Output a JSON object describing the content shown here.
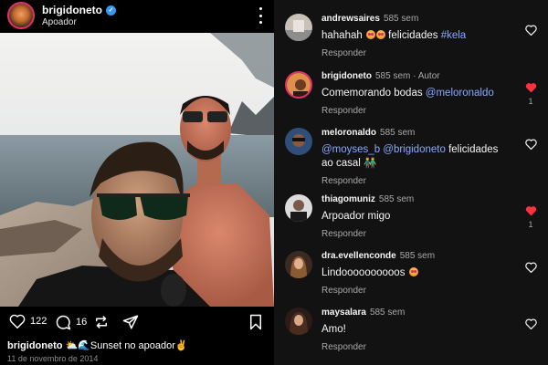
{
  "post": {
    "username": "brigidoneto",
    "location": "Apoador",
    "likes": "122",
    "comments": "16",
    "caption_user": "brigidoneto",
    "caption_text": "⛅🌊Sunset no apoador✌",
    "date": "11 de novembro de 2014"
  },
  "comments": [
    {
      "user": "andrewsaires",
      "time": "585 sem",
      "author_tag": "",
      "text": "hahahah ",
      "emojis": 2,
      "text_after": " felicidades ",
      "mention": "#kela",
      "reply": "Responder",
      "liked": false,
      "like_count": ""
    },
    {
      "user": "brigidoneto",
      "time": "585 sem",
      "author_tag": "· Autor",
      "text": "Comemorando bodas ",
      "emojis": 0,
      "text_after": "",
      "mention": "@meloronaldo",
      "reply": "Responder",
      "liked": true,
      "like_count": "1"
    },
    {
      "user": "meloronaldo",
      "time": "585 sem",
      "author_tag": "",
      "text": "",
      "emojis": 0,
      "text_after": "",
      "mention": "@moyses_b @brigidoneto",
      "text_tail": " felicidades ao casal 👬",
      "reply": "Responder",
      "liked": false,
      "like_count": ""
    },
    {
      "user": "thiagomuniz",
      "time": "585 sem",
      "author_tag": "",
      "text": "Arpoador migo",
      "emojis": 0,
      "text_after": "",
      "mention": "",
      "reply": "Responder",
      "liked": true,
      "like_count": "1"
    },
    {
      "user": "dra.evellenconde",
      "time": "585 sem",
      "author_tag": "",
      "text": "Lindoooooooooos ",
      "emojis": 1,
      "text_after": "",
      "mention": "",
      "reply": "Responder",
      "liked": false,
      "like_count": ""
    },
    {
      "user": "maysalara",
      "time": "585 sem",
      "author_tag": "",
      "text": "Amo!",
      "emojis": 0,
      "text_after": "",
      "mention": "",
      "reply": "Responder",
      "liked": false,
      "like_count": ""
    }
  ],
  "colors": {
    "verified": "#3897f0",
    "like_red": "#ff3040",
    "mention": "#8aa8ff",
    "bg_comments": "#121212"
  }
}
